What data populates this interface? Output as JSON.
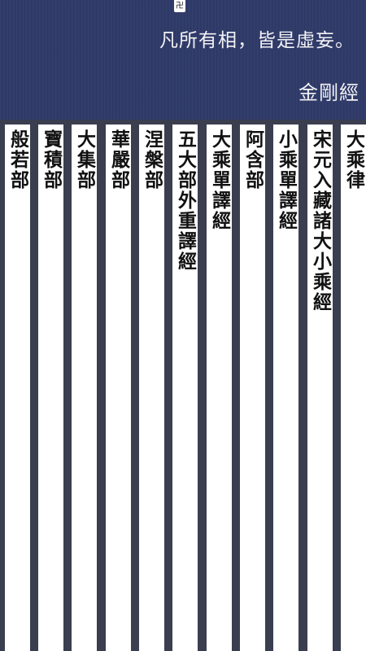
{
  "header": {
    "seal_glyph": "卍",
    "quote": "凡所有相，皆是虛妄。",
    "source": "金剛經"
  },
  "categories": [
    {
      "id": "dacheng-lu",
      "label": "大乘律"
    },
    {
      "id": "song-yuan",
      "label": "宋元入藏諸大小乘經"
    },
    {
      "id": "xiaocheng-danyi",
      "label": "小乘單譯經"
    },
    {
      "id": "ahan",
      "label": "阿含部"
    },
    {
      "id": "dacheng-danyi",
      "label": "大乘單譯經"
    },
    {
      "id": "wudabu",
      "label": "五大部外重譯經"
    },
    {
      "id": "niepan",
      "label": "涅槃部"
    },
    {
      "id": "huayan",
      "label": "華嚴部"
    },
    {
      "id": "daji",
      "label": "大集部"
    },
    {
      "id": "baoji",
      "label": "寶積部"
    },
    {
      "id": "bore",
      "label": "般若部"
    }
  ],
  "colors": {
    "header_bg": "#2f3a69",
    "page_bg": "#3a3e4f",
    "strip_bg": "#ffffff",
    "text_dark": "#111111",
    "text_light": "#f2f2f5"
  }
}
